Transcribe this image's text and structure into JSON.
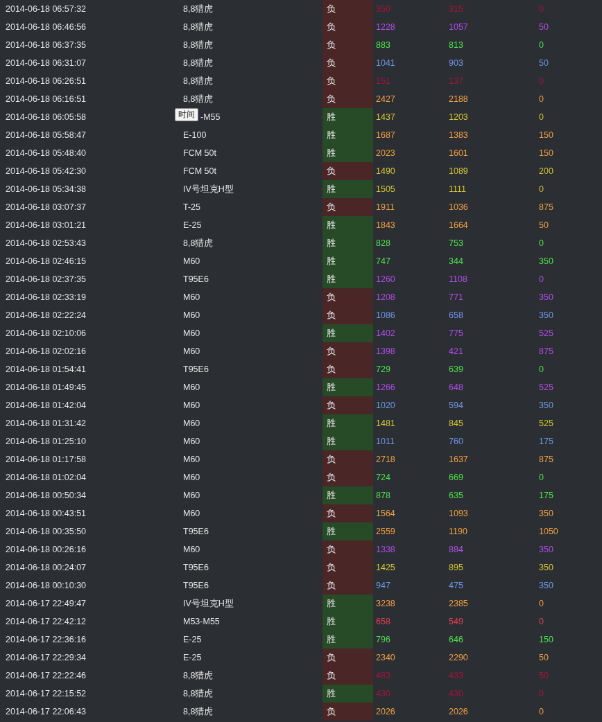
{
  "rows": [
    {
      "time": "2014-06-18 06:57:32",
      "tank": "8,8猎虎",
      "result": "负",
      "win": false,
      "color": "#a3163a",
      "scores": [
        "350",
        "315",
        "0"
      ]
    },
    {
      "time": "2014-06-18 06:46:56",
      "tank": "8,8猎虎",
      "result": "负",
      "win": false,
      "color": "#b24ee8",
      "scores": [
        "1228",
        "1057",
        "50"
      ]
    },
    {
      "time": "2014-06-18 06:37:35",
      "tank": "8,8猎虎",
      "result": "负",
      "win": false,
      "color": "#4fe24f",
      "scores": [
        "883",
        "813",
        "0"
      ]
    },
    {
      "time": "2014-06-18 06:31:07",
      "tank": "8,8猎虎",
      "result": "负",
      "win": false,
      "color": "#7097e6",
      "scores": [
        "1041",
        "903",
        "50"
      ]
    },
    {
      "time": "2014-06-18 06:26:51",
      "tank": "8,8猎虎",
      "result": "负",
      "win": false,
      "color": "#a3163a",
      "scores": [
        "151",
        "137",
        "0"
      ]
    },
    {
      "time": "2014-06-18 06:16:51",
      "tank": "8,8猎虎",
      "result": "负",
      "win": false,
      "color": "#f2a144",
      "scores": [
        "2427",
        "2188",
        "0"
      ]
    },
    {
      "time": "2014-06-18 06:05:58",
      "tank": "-M55",
      "tooltip": "时间",
      "result": "胜",
      "win": true,
      "color": "#d6c832",
      "scores": [
        "1437",
        "1203",
        "0"
      ]
    },
    {
      "time": "2014-06-18 05:58:47",
      "tank": "E-100",
      "result": "胜",
      "win": true,
      "color": "#f2a144",
      "scores": [
        "1687",
        "1383",
        "150"
      ]
    },
    {
      "time": "2014-06-18 05:48:40",
      "tank": "FCM 50t",
      "result": "胜",
      "win": true,
      "color": "#f2a144",
      "scores": [
        "2023",
        "1601",
        "150"
      ]
    },
    {
      "time": "2014-06-18 05:42:30",
      "tank": "FCM 50t",
      "result": "负",
      "win": false,
      "color": "#d6c832",
      "scores": [
        "1490",
        "1089",
        "200"
      ]
    },
    {
      "time": "2014-06-18 05:34:38",
      "tank": "IV号坦克H型",
      "result": "胜",
      "win": true,
      "color": "#d6c832",
      "scores": [
        "1505",
        "1111",
        "0"
      ]
    },
    {
      "time": "2014-06-18 03:07:37",
      "tank": "T-25",
      "result": "负",
      "win": false,
      "color": "#f2a144",
      "scores": [
        "1911",
        "1036",
        "875"
      ]
    },
    {
      "time": "2014-06-18 03:01:21",
      "tank": "E-25",
      "result": "胜",
      "win": true,
      "color": "#f2a144",
      "scores": [
        "1843",
        "1664",
        "50"
      ]
    },
    {
      "time": "2014-06-18 02:53:43",
      "tank": "8,8猎虎",
      "result": "胜",
      "win": true,
      "color": "#4fe24f",
      "scores": [
        "828",
        "753",
        "0"
      ]
    },
    {
      "time": "2014-06-18 02:46:15",
      "tank": "M60",
      "result": "胜",
      "win": true,
      "color": "#4fe24f",
      "scores": [
        "747",
        "344",
        "350"
      ]
    },
    {
      "time": "2014-06-18 02:37:35",
      "tank": "T95E6",
      "result": "胜",
      "win": true,
      "color": "#b24ee8",
      "scores": [
        "1260",
        "1108",
        "0"
      ]
    },
    {
      "time": "2014-06-18 02:33:19",
      "tank": "M60",
      "result": "负",
      "win": false,
      "color": "#b24ee8",
      "scores": [
        "1208",
        "771",
        "350"
      ]
    },
    {
      "time": "2014-06-18 02:22:24",
      "tank": "M60",
      "result": "负",
      "win": false,
      "color": "#7097e6",
      "scores": [
        "1086",
        "658",
        "350"
      ]
    },
    {
      "time": "2014-06-18 02:10:06",
      "tank": "M60",
      "result": "胜",
      "win": true,
      "color": "#b24ee8",
      "scores": [
        "1402",
        "775",
        "525"
      ]
    },
    {
      "time": "2014-06-18 02:02:16",
      "tank": "M60",
      "result": "负",
      "win": false,
      "color": "#b24ee8",
      "scores": [
        "1398",
        "421",
        "875"
      ]
    },
    {
      "time": "2014-06-18 01:54:41",
      "tank": "T95E6",
      "result": "负",
      "win": false,
      "color": "#4fe24f",
      "scores": [
        "729",
        "639",
        "0"
      ]
    },
    {
      "time": "2014-06-18 01:49:45",
      "tank": "M60",
      "result": "胜",
      "win": true,
      "color": "#b24ee8",
      "scores": [
        "1266",
        "648",
        "525"
      ]
    },
    {
      "time": "2014-06-18 01:42:04",
      "tank": "M60",
      "result": "负",
      "win": false,
      "color": "#7097e6",
      "scores": [
        "1020",
        "594",
        "350"
      ]
    },
    {
      "time": "2014-06-18 01:31:42",
      "tank": "M60",
      "result": "胜",
      "win": true,
      "color": "#d6c832",
      "scores": [
        "1481",
        "845",
        "525"
      ]
    },
    {
      "time": "2014-06-18 01:25:10",
      "tank": "M60",
      "result": "胜",
      "win": true,
      "color": "#7097e6",
      "scores": [
        "1011",
        "760",
        "175"
      ]
    },
    {
      "time": "2014-06-18 01:17:58",
      "tank": "M60",
      "result": "负",
      "win": false,
      "color": "#f2a144",
      "scores": [
        "2718",
        "1637",
        "875"
      ]
    },
    {
      "time": "2014-06-18 01:02:04",
      "tank": "M60",
      "result": "负",
      "win": false,
      "color": "#4fe24f",
      "scores": [
        "724",
        "669",
        "0"
      ]
    },
    {
      "time": "2014-06-18 00:50:34",
      "tank": "M60",
      "result": "胜",
      "win": true,
      "color": "#4fe24f",
      "scores": [
        "878",
        "635",
        "175"
      ]
    },
    {
      "time": "2014-06-18 00:43:51",
      "tank": "M60",
      "result": "负",
      "win": false,
      "color": "#f2a144",
      "scores": [
        "1564",
        "1093",
        "350"
      ]
    },
    {
      "time": "2014-06-18 00:35:50",
      "tank": "T95E6",
      "result": "胜",
      "win": true,
      "color": "#f2a144",
      "scores": [
        "2559",
        "1190",
        "1050"
      ]
    },
    {
      "time": "2014-06-18 00:26:16",
      "tank": "M60",
      "result": "负",
      "win": false,
      "color": "#b24ee8",
      "scores": [
        "1338",
        "884",
        "350"
      ]
    },
    {
      "time": "2014-06-18 00:24:07",
      "tank": "T95E6",
      "result": "负",
      "win": false,
      "color": "#d6c832",
      "scores": [
        "1425",
        "895",
        "350"
      ]
    },
    {
      "time": "2014-06-18 00:10:30",
      "tank": "T95E6",
      "result": "负",
      "win": false,
      "color": "#7097e6",
      "scores": [
        "947",
        "475",
        "350"
      ]
    },
    {
      "time": "2014-06-17 22:49:47",
      "tank": "IV号坦克H型",
      "result": "胜",
      "win": true,
      "color": "#f2a144",
      "scores": [
        "3238",
        "2385",
        "0"
      ]
    },
    {
      "time": "2014-06-17 22:42:12",
      "tank": "M53-M55",
      "result": "胜",
      "win": true,
      "color": "#e2404c",
      "scores": [
        "658",
        "549",
        "0"
      ]
    },
    {
      "time": "2014-06-17 22:36:16",
      "tank": "E-25",
      "result": "胜",
      "win": true,
      "color": "#4fe24f",
      "scores": [
        "796",
        "646",
        "150"
      ]
    },
    {
      "time": "2014-06-17 22:29:34",
      "tank": "E-25",
      "result": "负",
      "win": false,
      "color": "#f2a144",
      "scores": [
        "2340",
        "2290",
        "50"
      ]
    },
    {
      "time": "2014-06-17 22:22:46",
      "tank": "8,8猎虎",
      "result": "负",
      "win": false,
      "color": "#a3163a",
      "scores": [
        "483",
        "433",
        "50"
      ]
    },
    {
      "time": "2014-06-17 22:15:52",
      "tank": "8,8猎虎",
      "result": "胜",
      "win": true,
      "color": "#a3163a",
      "scores": [
        "430",
        "430",
        "0"
      ]
    },
    {
      "time": "2014-06-17 22:06:43",
      "tank": "8,8猎虎",
      "result": "负",
      "win": false,
      "color": "#f2a144",
      "scores": [
        "2026",
        "2026",
        "0"
      ]
    }
  ]
}
